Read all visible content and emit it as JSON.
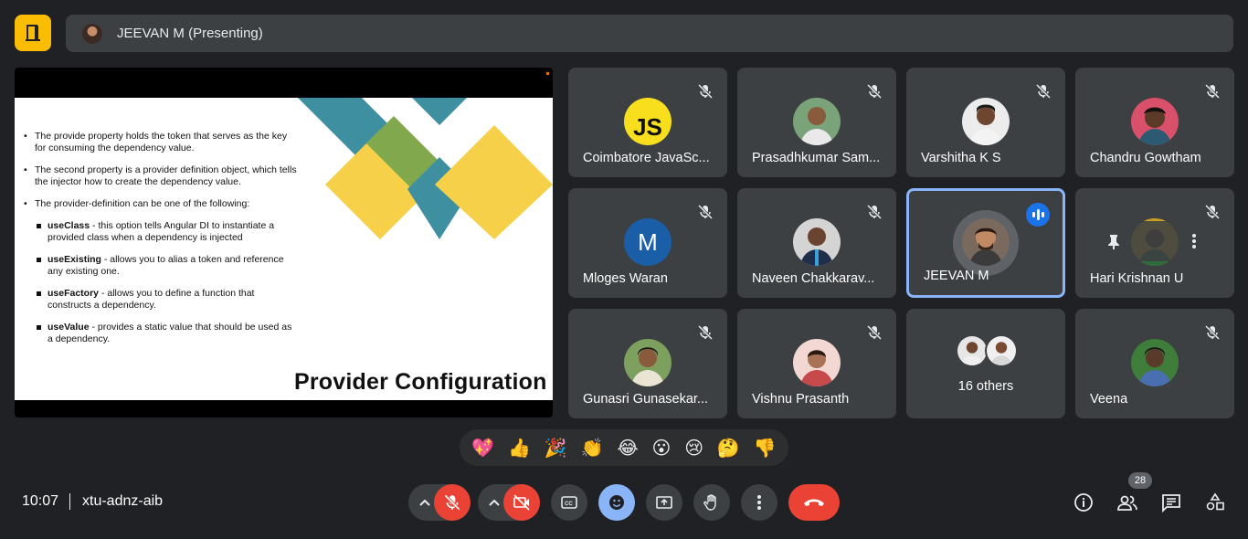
{
  "header": {
    "presenter_label": "JEEVAN M (Presenting)"
  },
  "slide": {
    "bullets": [
      "The provide property holds the token that serves as the key for consuming the dependency value.",
      "The second property is a provider definition object, which tells the injector how to create the dependency value.",
      "The provider-definition can be one of the following:"
    ],
    "sub_items": [
      {
        "term": "useClass",
        "text": " - this option tells Angular DI to instantiate a provided class when a dependency is injected"
      },
      {
        "term": "useExisting",
        "text": " - allows you to alias a token and reference any existing one."
      },
      {
        "term": "useFactory",
        "text": " - allows you to define a function that constructs a dependency."
      },
      {
        "term": "useValue",
        "text": " - provides a static value that should be used as a dependency."
      }
    ],
    "title": "Provider Configuration"
  },
  "participants": [
    {
      "name": "Coimbatore JavaSc...",
      "avatar": "JS",
      "muted": true
    },
    {
      "name": "Prasadhkumar Sam...",
      "avatar": "photo",
      "muted": true
    },
    {
      "name": "Varshitha K S",
      "avatar": "photo",
      "muted": true
    },
    {
      "name": "Chandru Gowtham",
      "avatar": "photo",
      "muted": true
    },
    {
      "name": "Mloges Waran",
      "avatar": "M",
      "muted": true
    },
    {
      "name": "Naveen Chakkarav...",
      "avatar": "photo",
      "muted": true
    },
    {
      "name": "JEEVAN M",
      "avatar": "photo",
      "muted": false,
      "speaking": true
    },
    {
      "name": "Hari Krishnan U",
      "avatar": "photo",
      "muted": true
    },
    {
      "name": "Gunasri Gunasekar...",
      "avatar": "photo",
      "muted": true
    },
    {
      "name": "Vishnu Prasanth",
      "avatar": "photo",
      "muted": true
    },
    {
      "name": "16 others",
      "avatar": "group",
      "muted": false
    },
    {
      "name": "Veena",
      "avatar": "photo",
      "muted": true
    }
  ],
  "reactions": [
    "💖",
    "👍",
    "🎉",
    "👏",
    "😂",
    "😮",
    "😢",
    "🤔",
    "👎"
  ],
  "footer": {
    "time": "10:07",
    "meeting_code": "xtu-adnz-aib",
    "people_count": "28"
  },
  "colors": {
    "background": "#202124",
    "tile": "#3c4043",
    "accent_yellow": "#fbbc04",
    "end_call_red": "#ea4335",
    "active_blue": "#8ab4f8"
  }
}
